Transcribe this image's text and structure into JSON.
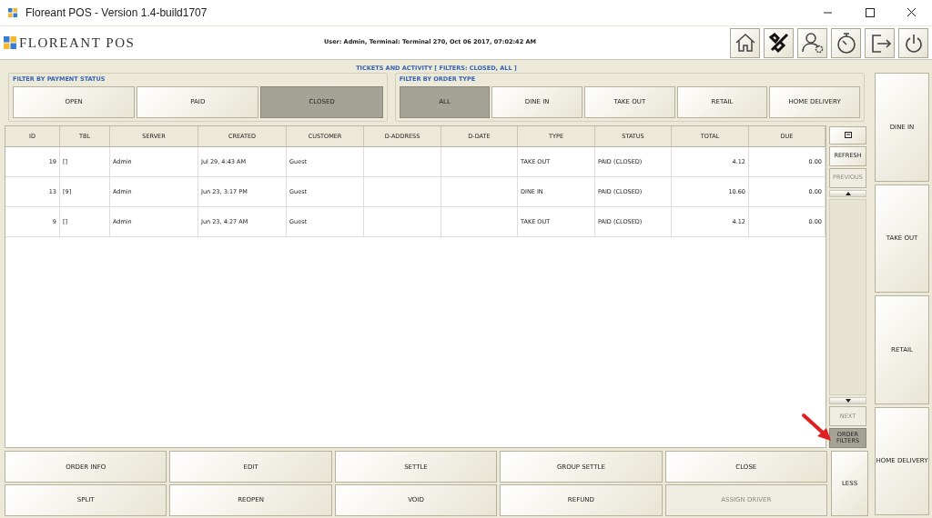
{
  "window": {
    "title": "Floreant POS - Version 1.4-build1707"
  },
  "header": {
    "logo_text": "FLOREANT POS",
    "status": "User: Admin, Terminal: Terminal 270, Oct 06 2017, 07:02:42 AM",
    "tools": [
      {
        "kind": "home"
      },
      {
        "kind": "tools"
      },
      {
        "kind": "user"
      },
      {
        "kind": "timer"
      },
      {
        "kind": "logout"
      },
      {
        "kind": "power"
      }
    ]
  },
  "panel_title": "TICKETS AND ACTIVITY [ FILTERS: CLOSED, ALL ]",
  "payment_filter": {
    "legend": "FILTER BY PAYMENT STATUS",
    "options": [
      {
        "label": "OPEN",
        "selected": false
      },
      {
        "label": "PAID",
        "selected": false
      },
      {
        "label": "CLOSED",
        "selected": true
      }
    ]
  },
  "order_type_filter": {
    "legend": "FILTER BY ORDER TYPE",
    "options": [
      {
        "label": "ALL",
        "selected": true
      },
      {
        "label": "DINE IN",
        "selected": false
      },
      {
        "label": "TAKE OUT",
        "selected": false
      },
      {
        "label": "RETAIL",
        "selected": false
      },
      {
        "label": "HOME DELIVERY",
        "selected": false
      }
    ]
  },
  "table": {
    "columns": [
      "ID",
      "TBL",
      "SERVER",
      "CREATED",
      "CUSTOMER",
      "D-ADDRESS",
      "D-DATE",
      "TYPE",
      "STATUS",
      "TOTAL",
      "DUE"
    ],
    "rows": [
      [
        "19",
        "[]",
        "Admin",
        "Jul 29, 4:43 AM",
        "Guest",
        "",
        "",
        "TAKE OUT",
        "PAID (CLOSED)",
        "4.12",
        "0.00"
      ],
      [
        "13",
        "[9]",
        "Admin",
        "Jun 23, 3:17 PM",
        "Guest",
        "",
        "",
        "DINE IN",
        "PAID (CLOSED)",
        "10.60",
        "0.00"
      ],
      [
        "9",
        "[]",
        "Admin",
        "Jun 23, 4:27 AM",
        "Guest",
        "",
        "",
        "TAKE OUT",
        "PAID (CLOSED)",
        "4.12",
        "0.00"
      ]
    ]
  },
  "side_buttons": [
    {
      "kind": "icon",
      "disabled": false,
      "selected": false
    },
    {
      "kind": "text",
      "label": "REFRESH",
      "disabled": false,
      "selected": false
    },
    {
      "kind": "text",
      "label": "PREVIOUS",
      "disabled": true,
      "selected": false
    },
    {
      "kind": "scroll"
    },
    {
      "kind": "text",
      "label": "NEXT",
      "disabled": true,
      "selected": false
    },
    {
      "kind": "text",
      "label": "ORDER FILTERS",
      "disabled": false,
      "selected": true
    }
  ],
  "action_buttons": [
    {
      "label": "ORDER INFO",
      "disabled": false
    },
    {
      "label": "EDIT",
      "disabled": false
    },
    {
      "label": "SETTLE",
      "disabled": false
    },
    {
      "label": "GROUP SETTLE",
      "disabled": false
    },
    {
      "label": "CLOSE",
      "disabled": false
    },
    {
      "label": "SPLIT",
      "disabled": false
    },
    {
      "label": "REOPEN",
      "disabled": false
    },
    {
      "label": "VOID",
      "disabled": false
    },
    {
      "label": "REFUND",
      "disabled": false
    },
    {
      "label": "ASSIGN DRIVER",
      "disabled": true
    }
  ],
  "less_button": "LESS",
  "order_type_buttons": [
    "DINE IN",
    "TAKE OUT",
    "RETAIL",
    "HOME DELIVERY"
  ]
}
